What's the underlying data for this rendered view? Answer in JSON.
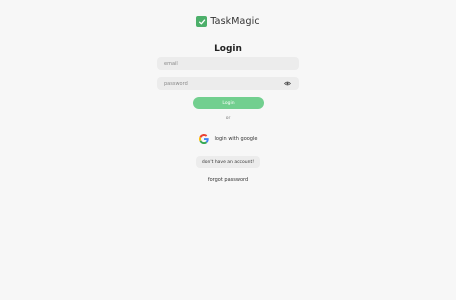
{
  "brand": {
    "name": "TaskMagic",
    "color": "#4caf6a",
    "icon": "check-icon"
  },
  "title": "Login",
  "form": {
    "email_placeholder": "email",
    "email_value": "",
    "password_placeholder": "password",
    "password_value": "",
    "password_toggle_icon": "eye-icon",
    "login_label": "Login",
    "login_color": "#72cf8f"
  },
  "divider_text": "or",
  "google": {
    "label": "login with google",
    "icon": "google-icon"
  },
  "signup_label": "don't have an account!",
  "forgot_label": "forgot password",
  "background": "#f7f7f7"
}
